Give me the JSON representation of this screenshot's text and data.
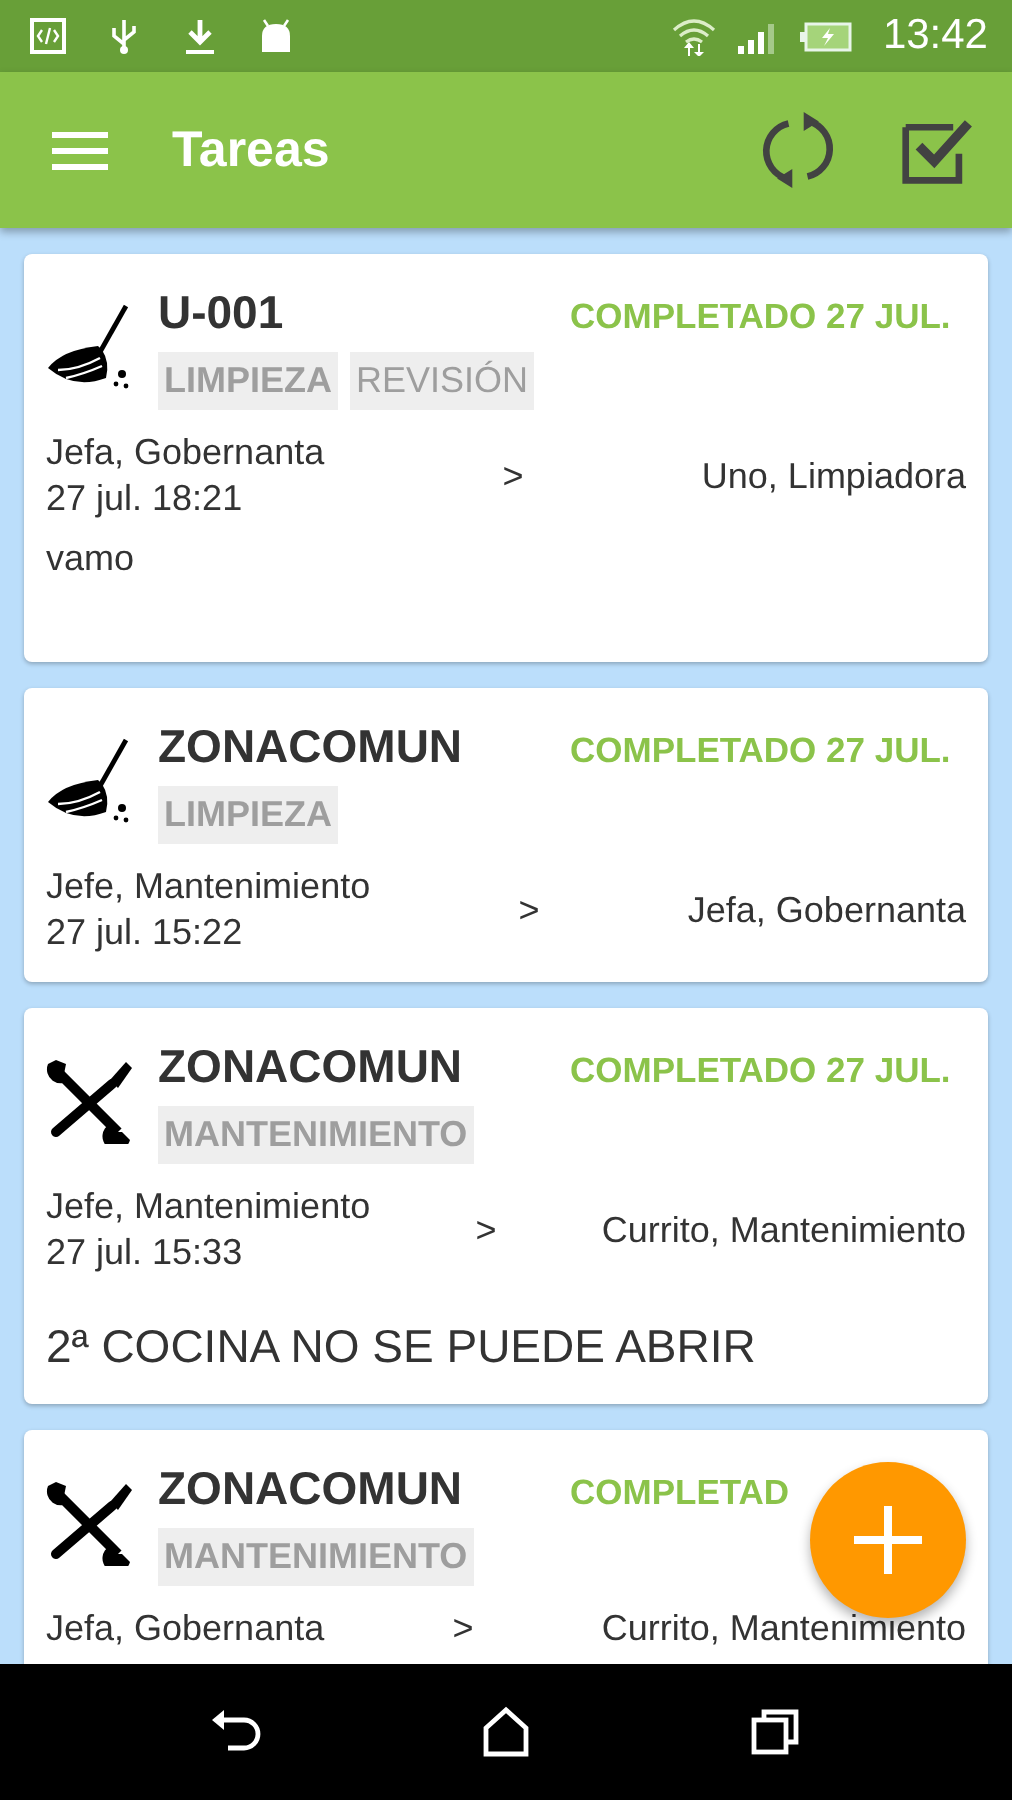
{
  "status_bar": {
    "time": "13:42"
  },
  "toolbar": {
    "title": "Tareas"
  },
  "tasks": [
    {
      "kind": "broom",
      "title": "U-001",
      "status": "COMPLETADO 27 JUL.",
      "tags": [
        {
          "label": "LIMPIEZA",
          "emphasis": true
        },
        {
          "label": "REVISIÓN",
          "emphasis": false
        }
      ],
      "from": "Jefa, Gobernanta",
      "date": "27 jul. 18:21",
      "arrow": ">",
      "to": "Uno, Limpiadora",
      "note": "vamo",
      "note_large": false
    },
    {
      "kind": "broom",
      "title": "ZONACOMUN",
      "status": "COMPLETADO 27 JUL.",
      "tags": [
        {
          "label": "LIMPIEZA",
          "emphasis": true
        }
      ],
      "from": "Jefe, Mantenimiento",
      "date": "27 jul. 15:22",
      "arrow": ">",
      "to": "Jefa, Gobernanta"
    },
    {
      "kind": "tools",
      "title": "ZONACOMUN",
      "status": "COMPLETADO 27 JUL.",
      "tags": [
        {
          "label": "MANTENIMIENTO",
          "emphasis": true
        }
      ],
      "from": "Jefe, Mantenimiento",
      "date": "27 jul. 15:33",
      "arrow": ">",
      "to": "Currito, Mantenimiento",
      "note": "2ª COCINA NO SE PUEDE ABRIR",
      "note_large": true
    },
    {
      "kind": "tools",
      "title": "ZONACOMUN",
      "status": "COMPLETAD",
      "tags": [
        {
          "label": "MANTENIMIENTO",
          "emphasis": true
        }
      ],
      "from": "Jefa, Gobernanta",
      "arrow": ">",
      "to": "Currito, Mantenimiento"
    }
  ]
}
